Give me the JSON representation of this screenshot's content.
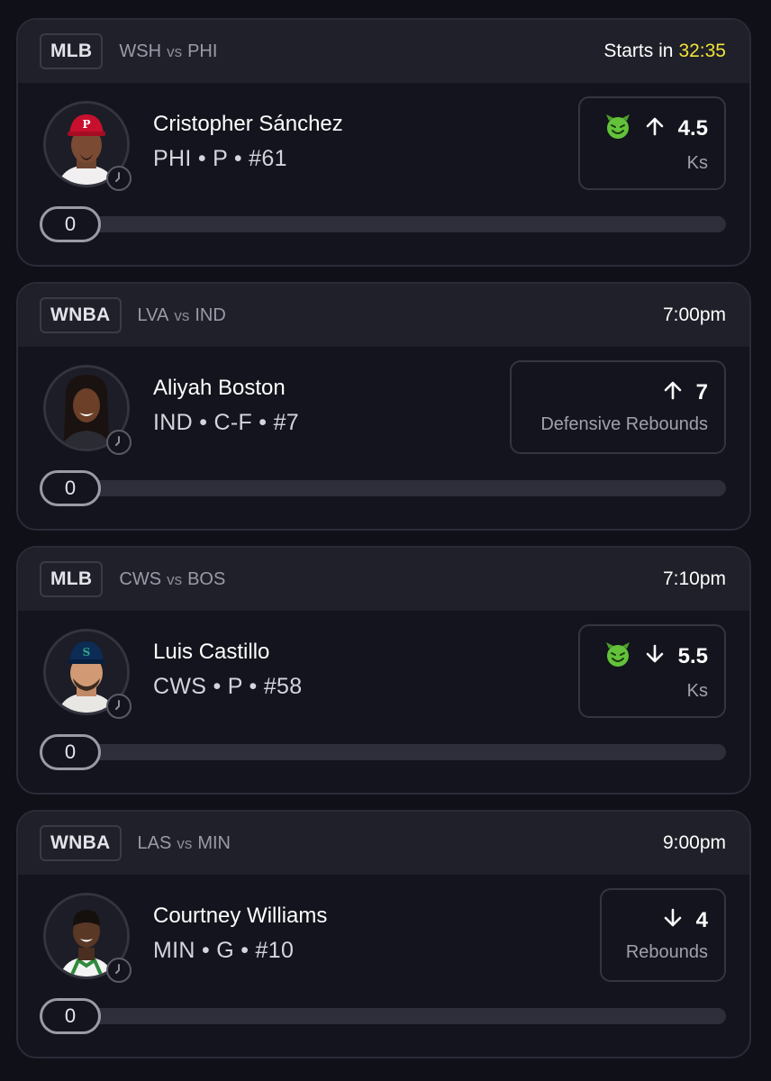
{
  "cards": [
    {
      "league": "MLB",
      "team_a": "WSH",
      "vs": "vs",
      "team_b": "PHI",
      "start_prefix": "Starts in",
      "start_value": "32:35",
      "player_name": "Cristopher Sánchez",
      "player_meta": "PHI • P • #61",
      "direction": "up",
      "line_value": "4.5",
      "stat": "Ks",
      "demon_badge": true,
      "progress_value": "0",
      "avatar": "baseball-player-phillies"
    },
    {
      "league": "WNBA",
      "team_a": "LVA",
      "vs": "vs",
      "team_b": "IND",
      "start_prefix": "",
      "start_value": "7:00pm",
      "player_name": "Aliyah Boston",
      "player_meta": "IND • C-F • #7",
      "direction": "up",
      "line_value": "7",
      "stat": "Defensive Rebounds",
      "demon_badge": false,
      "progress_value": "0",
      "avatar": "basketball-player-woman"
    },
    {
      "league": "MLB",
      "team_a": "CWS",
      "vs": "vs",
      "team_b": "BOS",
      "start_prefix": "",
      "start_value": "7:10pm",
      "player_name": "Luis Castillo",
      "player_meta": "CWS • P • #58",
      "direction": "down",
      "line_value": "5.5",
      "stat": "Ks",
      "demon_badge": true,
      "progress_value": "0",
      "avatar": "baseball-player-mariners"
    },
    {
      "league": "WNBA",
      "team_a": "LAS",
      "vs": "vs",
      "team_b": "MIN",
      "start_prefix": "",
      "start_value": "9:00pm",
      "player_name": "Courtney Williams",
      "player_meta": "MIN • G • #10",
      "direction": "down",
      "line_value": "4",
      "stat": "Rebounds",
      "demon_badge": false,
      "progress_value": "0",
      "avatar": "basketball-player-woman-2"
    }
  ],
  "colors": {
    "background": "#0f1018",
    "card": "#13141d",
    "header": "#1f2029",
    "countdown": "#f2e23a",
    "demon": "#63c23a"
  }
}
